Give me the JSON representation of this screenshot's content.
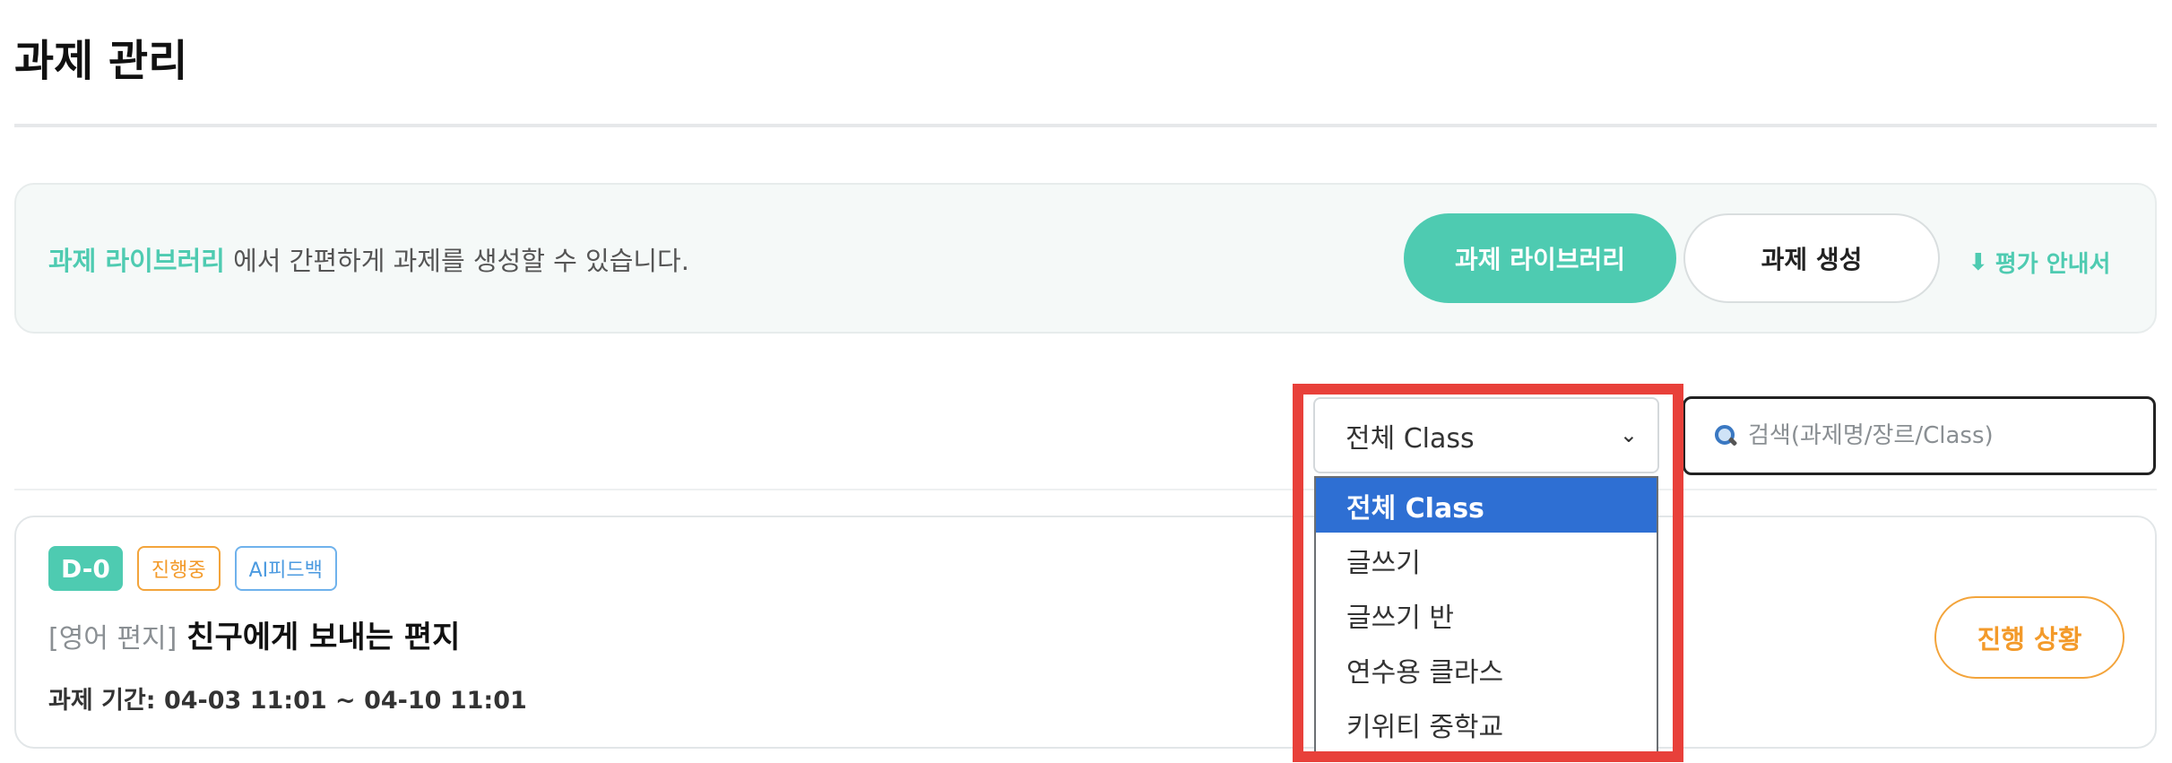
{
  "page": {
    "title": "과제 관리"
  },
  "banner": {
    "link_text": "과제 라이브러리",
    "text_rest": " 에서 간편하게 과제를 생성할 수 있습니다.",
    "library_button": "과제 라이브러리",
    "create_button": "과제 생성",
    "guide_link": "평가 안내서",
    "accent_color": "#4ecbb1"
  },
  "filter": {
    "class_select": {
      "selected": "전체 Class",
      "options": [
        "전체 Class",
        "글쓰기",
        "글쓰기 반",
        "연수용 클라스",
        "키위티 중학교"
      ]
    },
    "search": {
      "placeholder": "검색(과제명/장르/Class)",
      "value": ""
    }
  },
  "assignments": [
    {
      "d_day": "D-0",
      "status": "진행중",
      "feedback": "AI피드백",
      "genre": "[영어 편지]",
      "title": "친구에게 보내는 편지",
      "period": "과제 기간: 04-03 11:01 ~ 04-10 11:01",
      "action": "진행 상황"
    }
  ],
  "icons": {
    "guide": "download-arrow-icon",
    "search": "magnifier-icon",
    "select": "chevron-down-icon"
  },
  "colors": {
    "status_orange": "#f39a2a",
    "ai_blue": "#4b9ae0",
    "highlight_red": "#e8403a",
    "selected_option": "#2e6fd3"
  }
}
